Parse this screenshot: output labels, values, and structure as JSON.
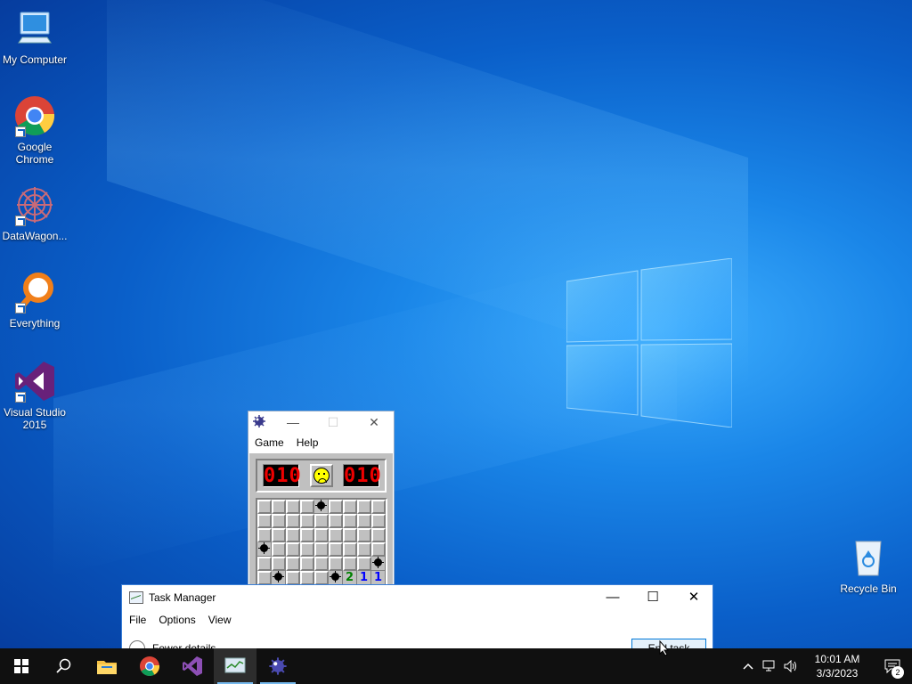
{
  "desktop": {
    "icons": [
      {
        "label": "My Computer",
        "icon": "computer-icon"
      },
      {
        "label": "Google\nChrome",
        "icon": "chrome-icon"
      },
      {
        "label": "DataWagon...",
        "icon": "datawagon-icon"
      },
      {
        "label": "Everything",
        "icon": "everything-search-icon"
      },
      {
        "label": "Visual Studio\n2015",
        "icon": "visual-studio-icon"
      },
      {
        "label": "Recycle Bin",
        "icon": "recycle-bin-icon"
      }
    ]
  },
  "minesweeper": {
    "menu": [
      "Game",
      "Help"
    ],
    "mine_counter": "010",
    "timer": "010",
    "face": "frown-face",
    "grid": [
      [
        "h",
        "h",
        "h",
        "h",
        "m",
        "h",
        "h",
        "h",
        "h"
      ],
      [
        "h",
        "h",
        "h",
        "h",
        "h",
        "h",
        "h",
        "h",
        "h"
      ],
      [
        "h",
        "h",
        "h",
        "h",
        "h",
        "h",
        "h",
        "h",
        "h"
      ],
      [
        "m",
        "h",
        "h",
        "h",
        "h",
        "h",
        "h",
        "h",
        "h"
      ],
      [
        "h",
        "h",
        "h",
        "h",
        "h",
        "h",
        "h",
        "h",
        "m"
      ],
      [
        "h",
        "m",
        "h",
        "h",
        "h",
        "m",
        "2",
        "1",
        "1"
      ]
    ]
  },
  "task_manager": {
    "title": "Task Manager",
    "menu": [
      "File",
      "Options",
      "View"
    ],
    "fewer_details": "Fewer details",
    "end_task": "End task",
    "caption": {
      "minimize": "—",
      "maximize": "☐",
      "close": "✕"
    }
  },
  "taskbar": {
    "apps": [
      "start",
      "search",
      "file-explorer",
      "chrome",
      "visual-studio",
      "task-manager",
      "minesweeper"
    ],
    "active_app": "task-manager",
    "clock_time": "10:01 AM",
    "clock_date": "3/3/2023",
    "notification_count": "2"
  },
  "colors": {
    "taskbar": "#101010",
    "accent": "#0078d7",
    "desktop": "#0a5fc9"
  }
}
